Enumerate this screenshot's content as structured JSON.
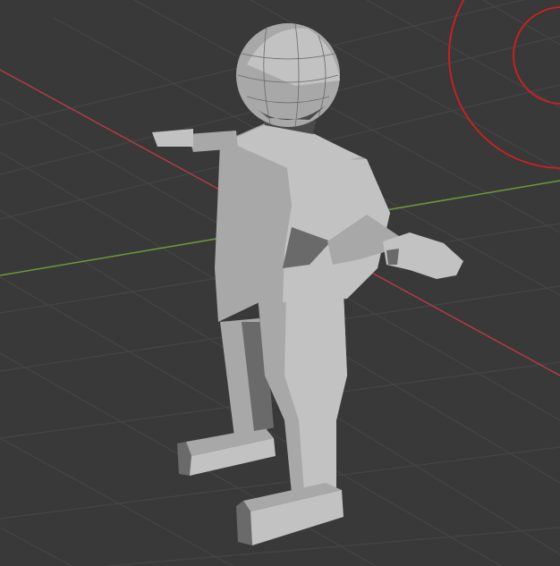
{
  "viewport": {
    "background_color": "#393939",
    "grid_color": "#454545",
    "x_axis_color": "#b33a46",
    "y_axis_color": "#6c9a3a",
    "light_gizmo_color": "#d02020"
  },
  "character": {
    "base_color": "#a8a8a8",
    "light_color": "#c2c2c2",
    "shadow_color": "#6a6a6a",
    "dark_color": "#4a4a4a"
  },
  "icons": [
    "light-gizmo-icon"
  ]
}
